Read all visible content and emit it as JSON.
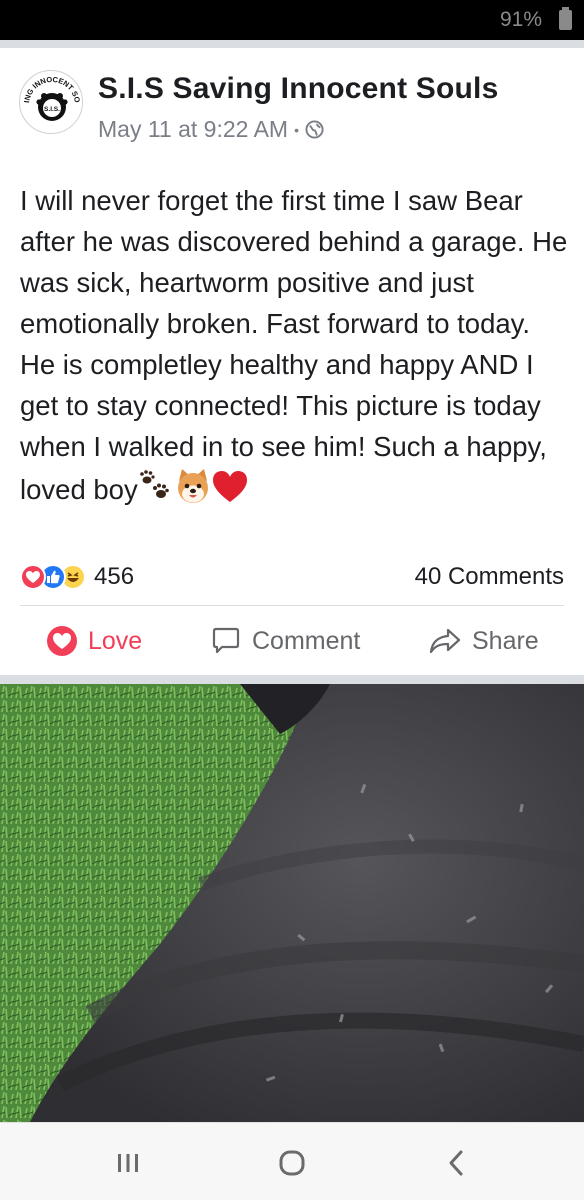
{
  "status_bar": {
    "battery_percent": "91%",
    "battery_icon": "battery-icon"
  },
  "post": {
    "page_name": "S.I.S Saving Innocent Souls",
    "avatar_logo_text": "SAVING INNOCENT SOULS S.I.S.",
    "timestamp": "May 11 at 9:22 AM",
    "separator": "•",
    "privacy_icon": "globe-icon",
    "body_text": "I will never forget the first time I saw Bear after he was discovered behind a garage. He was sick, heartworm positive and just emotionally broken. Fast forward to today. He is completley healthy and happy AND I get to stay connected! This picture is today when I walked in to see him! Such a happy, loved boy",
    "emojis": [
      "paw-prints-emoji",
      "dog-face-emoji",
      "red-heart-emoji"
    ],
    "reactions": {
      "icons": [
        "love-reaction-icon",
        "like-reaction-icon",
        "haha-reaction-icon"
      ],
      "count": "456"
    },
    "comments_count": "40 Comments"
  },
  "actions": {
    "love_label": "Love",
    "comment_label": "Comment",
    "share_label": "Share"
  },
  "photo": {
    "subject": "dog-photo"
  },
  "nav_bar": {
    "buttons": [
      "recents-icon",
      "home-icon",
      "back-icon"
    ]
  },
  "colors": {
    "love": "#f33e58",
    "like": "#2078f4",
    "haha": "#fcd34d",
    "text": "#1c1e21",
    "meta": "#7a7f87"
  }
}
